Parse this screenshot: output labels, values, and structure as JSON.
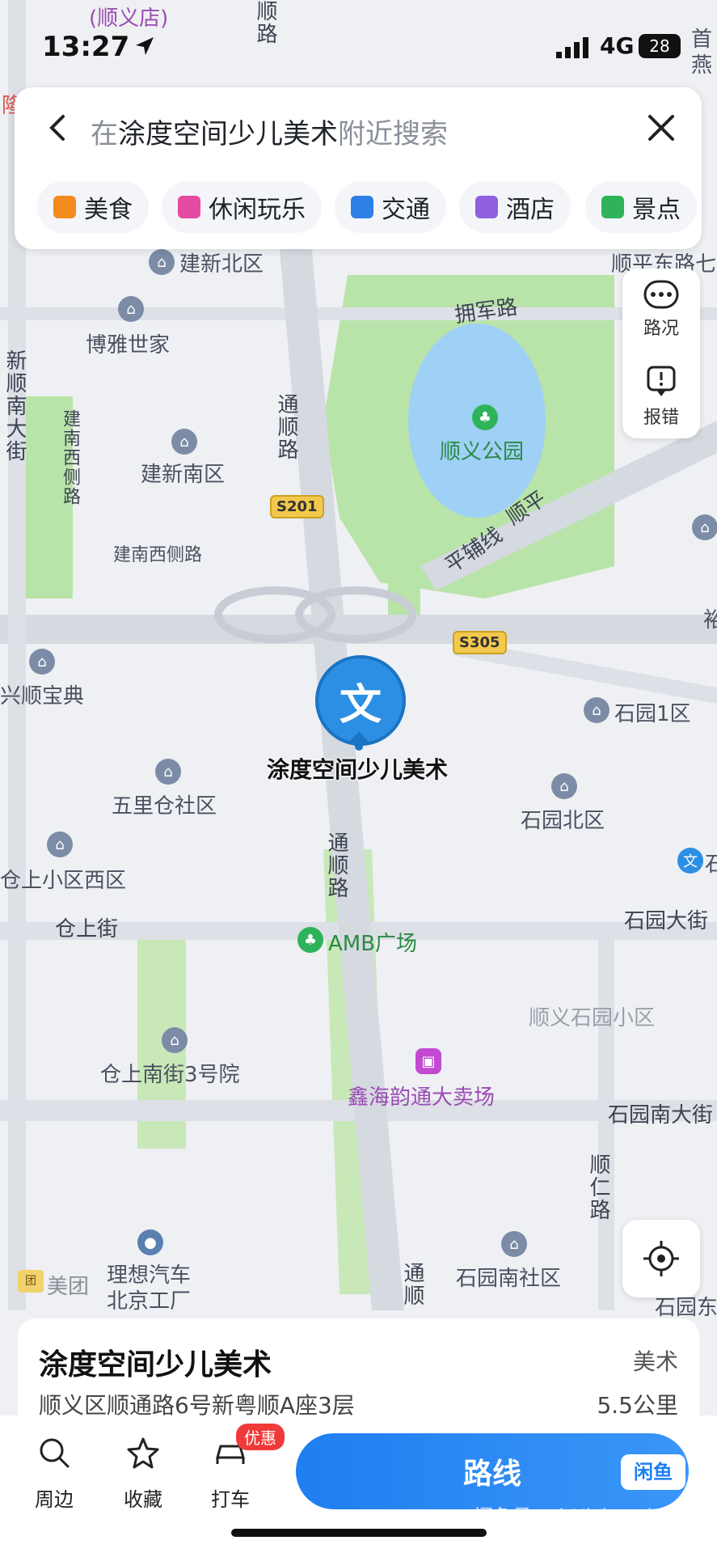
{
  "status_bar": {
    "time": "13:27",
    "network": "4G",
    "battery": "28"
  },
  "search": {
    "prefix": "在",
    "keyword": "涂度空间少儿美术",
    "suffix": "附近搜索"
  },
  "categories": [
    {
      "label": "美食",
      "color": "#f28a1d"
    },
    {
      "label": "休闲玩乐",
      "color": "#e54ba0"
    },
    {
      "label": "交通",
      "color": "#2f7fe8"
    },
    {
      "label": "酒店",
      "color": "#8f5fe0"
    },
    {
      "label": "景点",
      "color": "#2fb35a"
    }
  ],
  "right_tools": {
    "traffic_label": "路况",
    "report_label": "报错"
  },
  "map": {
    "pin_label": "涂度空间少儿美术",
    "pin_glyph": "文",
    "labels": {
      "top_mall": "(顺义店)",
      "top_road": "顺路",
      "top_right_1": "首",
      "top_right_2": "燕",
      "left_edge": "隆",
      "jianxin_north": "建新北区",
      "shunping_east": "顺平东路七",
      "yongjun_rd": "拥军路",
      "boya": "博雅世家",
      "xinshun_st": "新顺南大街",
      "jiannan_xice": "建南西侧路",
      "tongshun_rd": "通顺路",
      "shunyi_park": "顺义公园",
      "jianxin_south": "建新南区",
      "pinghai_line": "平辅线",
      "shunping_rd": "顺平",
      "jiannan_xice_2": "建南西侧路",
      "xingshun": "兴顺宝典",
      "shiyuan1": "石园1区",
      "wulicang": "五里仓社区",
      "shiyuan_north": "石园北区",
      "cangshang_west": "仓上小区西区",
      "wen_right": "石",
      "tongshun_rd_2": "通顺路",
      "cangshang_st": "仓上街",
      "amb": "AMB广场",
      "shiyuan_st": "石园大街",
      "shunyi_shiyuan": "顺义石园小区",
      "cangshang_south3": "仓上南街3号院",
      "xinhai": "鑫海韵通大卖场",
      "shiyuan_south_st": "石园南大街",
      "shunren_rd": "顺仁路",
      "lixiang_1": "理想汽车",
      "lixiang_2": "北京工厂",
      "shiyuan_south": "石园南社区",
      "tongshun_3": "通顺",
      "shiyuan_east": "石园东",
      "meituan": "美团",
      "yu": "裕"
    },
    "shields": {
      "s201": "S201",
      "s305": "S305"
    }
  },
  "place": {
    "name": "涂度空间少儿美术",
    "category": "美术",
    "address": "顺义区顺通路6号新粤顺A座3层",
    "distance": "5.5公里"
  },
  "bottom_bar": {
    "nearby": "周边",
    "favorites": "收藏",
    "taxi": "打车",
    "promo": "优惠",
    "route": "路线",
    "xianyu": "闲鱼"
  },
  "watermark": "闲鱼号：tbNick_qekxj"
}
